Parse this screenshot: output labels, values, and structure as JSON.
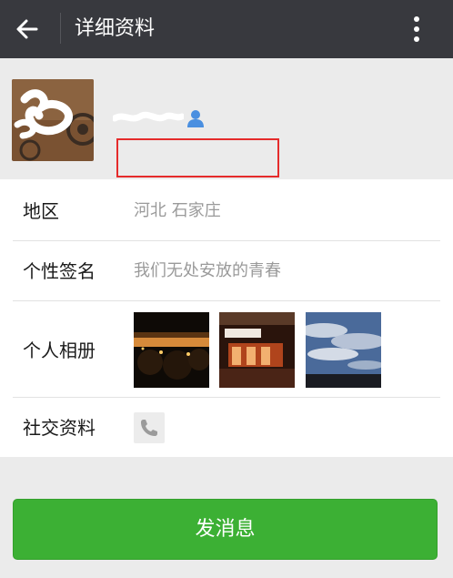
{
  "header": {
    "title": "详细资料",
    "back_icon": "arrow-left-icon",
    "menu_icon": "more-vertical-icon"
  },
  "profile": {
    "avatar_icon": "avatar-image",
    "contact_icon": "person-icon"
  },
  "rows": {
    "region": {
      "label": "地区",
      "value": "河北  石家庄"
    },
    "signature": {
      "label": "个性签名",
      "value": "我们无处安放的青春"
    },
    "album": {
      "label": "个人相册"
    },
    "social": {
      "label": "社交资料",
      "icon": "phone-icon"
    }
  },
  "actions": {
    "send_label": "发消息"
  },
  "colors": {
    "topbar": "#38393e",
    "accent_green": "#3cb034",
    "highlight_red": "#e52b2b",
    "contact_blue": "#4a8fe0"
  }
}
